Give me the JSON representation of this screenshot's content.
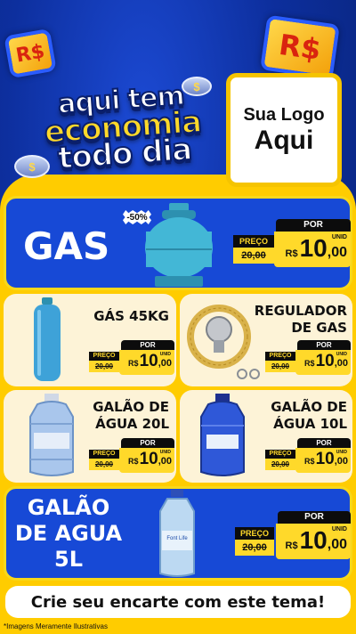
{
  "header": {
    "coin_symbol": "R$",
    "coin_symbol_small": "$",
    "slogan": [
      "aqui tem",
      "economia",
      "todo dia"
    ],
    "logo": [
      "Sua Logo",
      "Aqui"
    ]
  },
  "price_labels": {
    "preco": "PREÇO",
    "por": "POR",
    "currency": "R$",
    "unit": "UNID"
  },
  "products": [
    {
      "name": "GAS",
      "discount": "-50%",
      "old_price": "20,00",
      "new_whole": "10",
      "new_cents": ",00"
    },
    {
      "name": "GÁS 45KG",
      "old_price": "20,00",
      "new_whole": "10",
      "new_cents": ",00"
    },
    {
      "name": "REGULADOR DE GAS",
      "old_price": "20,00",
      "new_whole": "10",
      "new_cents": ",00"
    },
    {
      "name": "GALÃO DE ÁGUA 20L",
      "old_price": "20,00",
      "new_whole": "10",
      "new_cents": ",00"
    },
    {
      "name": "GALÃO DE ÁGUA 10L",
      "old_price": "20,00",
      "new_whole": "10",
      "new_cents": ",00"
    },
    {
      "name": "GALÃO DE AGUA 5L",
      "old_price": "20,00",
      "new_whole": "10",
      "new_cents": ",00",
      "bottle_brand": "Font Life"
    }
  ],
  "footer": {
    "cta": "Crie seu encarte com este tema!",
    "disclaimer": "*Imagens Meramente Ilustrativas"
  },
  "colors": {
    "blue": "#1749d6",
    "yellow": "#ffcc00",
    "cream": "#fdf3d7",
    "black": "#0c0c0c"
  }
}
